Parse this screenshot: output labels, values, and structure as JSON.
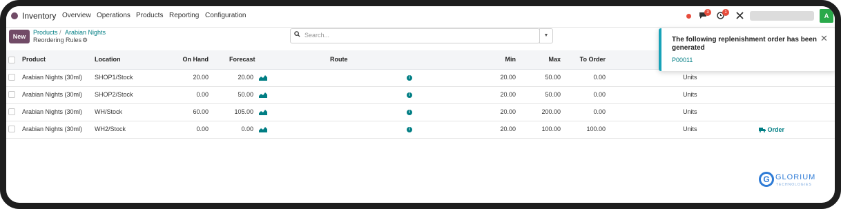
{
  "app": {
    "name": "Inventory"
  },
  "menu": [
    "Overview",
    "Operations",
    "Products",
    "Reporting",
    "Configuration"
  ],
  "systray": {
    "chat_badge": "3",
    "activity_badge": "1",
    "avatar_initial": "A"
  },
  "control": {
    "new_label": "New",
    "breadcrumb_parent": "Products",
    "breadcrumb_separator": "/",
    "breadcrumb_current": "Arabian Nights",
    "page_title": "Reordering Rules",
    "search_placeholder": "Search..."
  },
  "table": {
    "headers": {
      "product": "Product",
      "location": "Location",
      "on_hand": "On Hand",
      "forecast": "Forecast",
      "route": "Route",
      "min": "Min",
      "max": "Max",
      "to_order": "To Order"
    },
    "rows": [
      {
        "product": "Arabian Nights (30ml)",
        "location": "SHOP1/Stock",
        "on_hand": "20.00",
        "forecast": "20.00",
        "min": "20.00",
        "max": "50.00",
        "to_order": "0.00",
        "uom": "Units"
      },
      {
        "product": "Arabian Nights (30ml)",
        "location": "SHOP2/Stock",
        "on_hand": "0.00",
        "forecast": "50.00",
        "min": "20.00",
        "max": "50.00",
        "to_order": "0.00",
        "uom": "Units"
      },
      {
        "product": "Arabian Nights (30ml)",
        "location": "WH/Stock",
        "on_hand": "60.00",
        "forecast": "105.00",
        "min": "20.00",
        "max": "200.00",
        "to_order": "0.00",
        "uom": "Units"
      },
      {
        "product": "Arabian Nights (30ml)",
        "location": "WH2/Stock",
        "on_hand": "0.00",
        "forecast": "0.00",
        "min": "20.00",
        "max": "100.00",
        "to_order": "100.00",
        "uom": "Units"
      }
    ],
    "order_label": "Order"
  },
  "notification": {
    "message": "The following replenishment order has been generated",
    "link": "P00011"
  },
  "watermark": {
    "name": "GLORIUM",
    "sub": "TECHNOLOGIES"
  },
  "colors": {
    "brand": "#714b67",
    "link": "#017e84",
    "toast_accent": "#17a2b8",
    "alert": "#e74c3c"
  }
}
